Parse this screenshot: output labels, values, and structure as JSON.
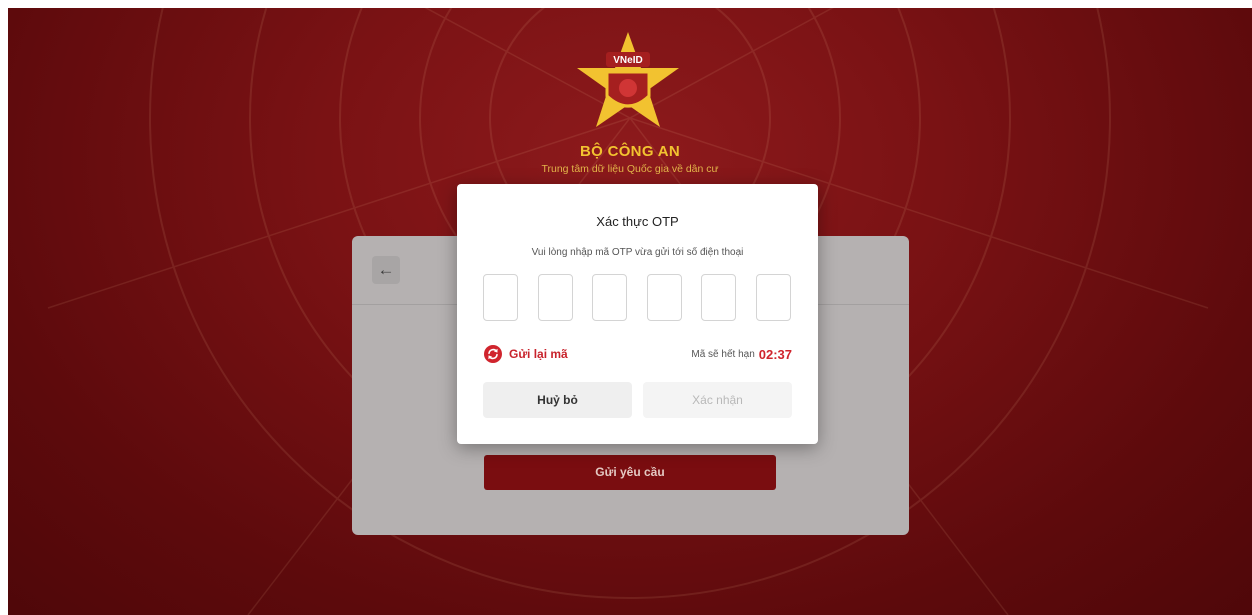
{
  "header": {
    "logo_text": "VNeID",
    "org_name": "BỘ CÔNG AN",
    "org_subtitle": "Trung tâm dữ liệu Quốc gia về dân cư"
  },
  "background_card": {
    "back_icon": "←",
    "submit_label": "Gửi yêu cầu"
  },
  "otp_modal": {
    "title": "Xác thực OTP",
    "instruction": "Vui lòng nhập mã OTP vừa gửi tới số điện thoại",
    "digits": [
      "",
      "",
      "",
      "",
      "",
      ""
    ],
    "resend_label": "Gửi lại mã",
    "expire_label": "Mã sẽ hết hạn",
    "countdown": "02:37",
    "cancel_label": "Huỷ bỏ",
    "confirm_label": "Xác nhận"
  },
  "colors": {
    "background": "#7a1214",
    "brand_gold": "#f2c230",
    "accent_red": "#c8232c",
    "submit_button": "#7a0d10"
  },
  "icons": {
    "back": "arrow-left-icon",
    "resend": "refresh-icon",
    "logo": "police-star-emblem"
  }
}
